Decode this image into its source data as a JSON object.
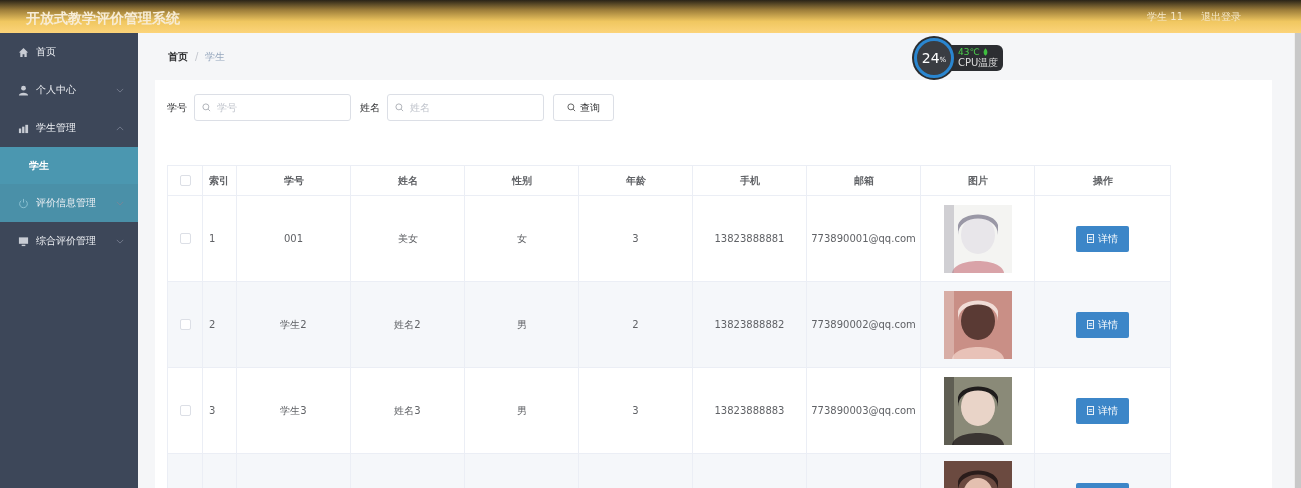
{
  "header": {
    "title": "开放式教学评价管理系统",
    "user": "学生 11",
    "logout": "退出登录"
  },
  "sidebar": {
    "items": [
      {
        "label": "首页",
        "hovered": false
      },
      {
        "label": "个人中心",
        "expanded": false,
        "hovered": false
      },
      {
        "label": "学生管理",
        "expanded": true,
        "hovered": false,
        "children": [
          {
            "label": "学生",
            "selected": true
          }
        ]
      },
      {
        "label": "评价信息管理",
        "expanded": false,
        "hovered": true
      },
      {
        "label": "综合评价管理",
        "expanded": false,
        "hovered": false
      }
    ]
  },
  "breadcrumb": {
    "items": [
      "首页",
      "学生"
    ],
    "separator": "/"
  },
  "search": {
    "fields": [
      {
        "label": "学号",
        "placeholder": "学号"
      },
      {
        "label": "姓名",
        "placeholder": "姓名"
      }
    ],
    "button": "查询"
  },
  "table": {
    "all_checked": false,
    "columns": [
      "索引",
      "学号",
      "姓名",
      "性别",
      "年龄",
      "手机",
      "邮箱",
      "图片",
      "操作"
    ],
    "rows": [
      {
        "checked": false,
        "cells": [
          "1",
          "001",
          "美女",
          "女",
          "3",
          "13823888881",
          "773890001@qq.com"
        ],
        "action": "详情"
      },
      {
        "checked": false,
        "cells": [
          "2",
          "学生2",
          "姓名2",
          "男",
          "2",
          "13823888882",
          "773890002@qq.com"
        ],
        "action": "详情"
      },
      {
        "checked": false,
        "cells": [
          "3",
          "学生3",
          "姓名3",
          "男",
          "3",
          "13823888883",
          "773890003@qq.com"
        ],
        "action": "详情"
      }
    ]
  },
  "cpu_widget": {
    "usage": "24",
    "unit": "%",
    "temperature": "43℃",
    "label": "CPU温度"
  }
}
